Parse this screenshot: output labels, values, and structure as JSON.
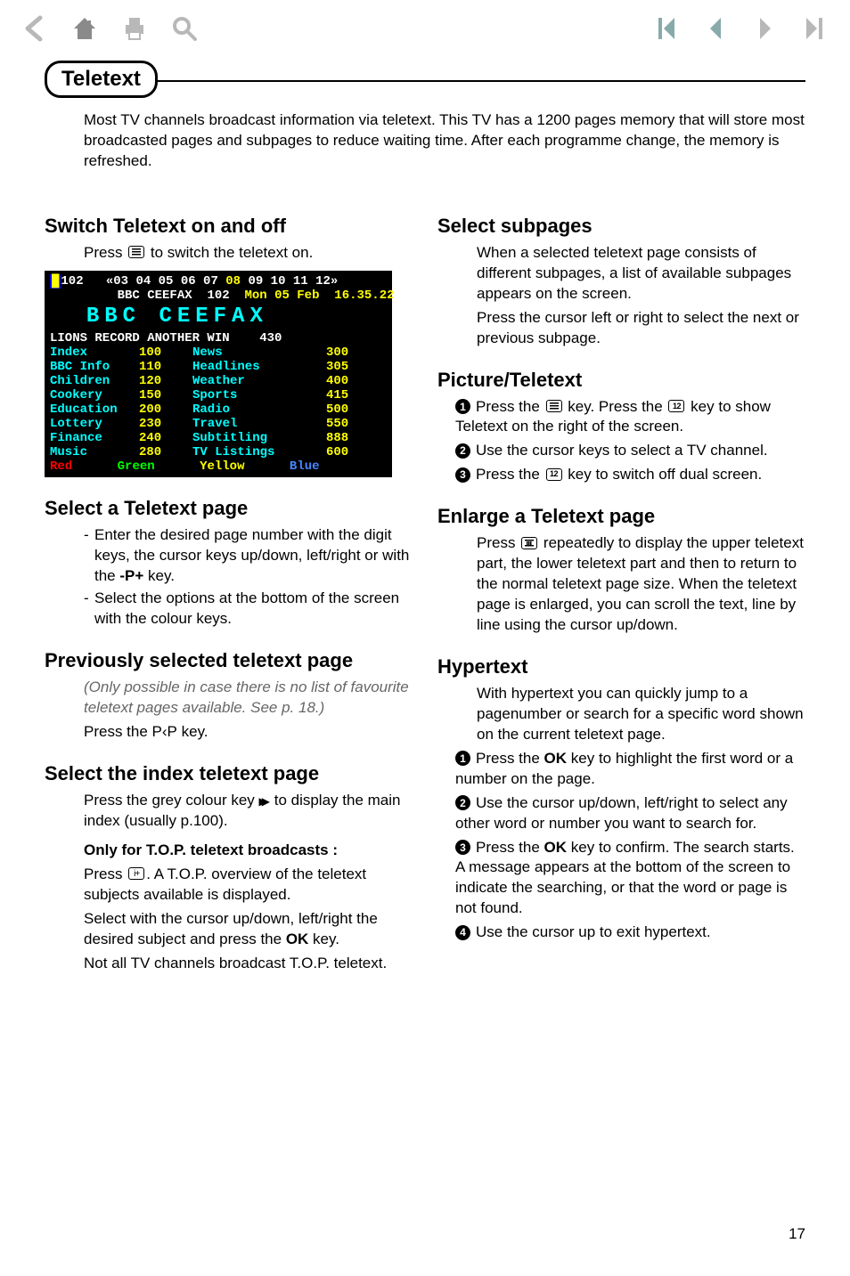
{
  "toolbar_icons": {
    "back": "back-icon",
    "home": "home-icon",
    "print": "print-icon",
    "search": "search-icon",
    "first": "first-page-icon",
    "prev": "prev-page-icon",
    "next": "next-page-icon",
    "last": "last-page-icon"
  },
  "badge": "Teletext",
  "intro": "Most TV channels broadcast information via teletext. This TV has a 1200 pages memory that will store most broadcasted pages and subpages to reduce waiting time.  After each programme change, the memory is refreshed.",
  "left": {
    "switch": {
      "title": "Switch Teletext on and off",
      "line1a": "Press ",
      "line1b": " to switch the teletext on."
    },
    "select_page": {
      "title": "Select a Teletext page",
      "b1": "Enter the desired page number with the digit keys, the cursor keys up/down, left/right or with the ",
      "b1key": "-P+",
      "b1after": " key.",
      "b2": "Select the options at the bottom of the screen with the colour keys."
    },
    "prev_page": {
      "title": "Previously selected teletext page",
      "note": "(Only possible in case there is no list of favourite teletext pages available. See p. 18.)",
      "line": "Press the ",
      "key": "P‹P",
      "after": " key."
    },
    "select_index": {
      "title": "Select the index teletext page",
      "line1a": "Press the grey colour key ",
      "line1b": " to display the main index (usually p.100).",
      "sub": "Only for T.O.P. teletext broadcasts :",
      "p2a": "Press ",
      "p2b": ".  A T.O.P. overview of the teletext subjects available is displayed.",
      "p3a": "Select with the cursor up/down, left/right the desired subject and press the ",
      "p3key": "OK",
      "p3b": " key.",
      "p4": "Not all TV channels broadcast T.O.P. teletext."
    }
  },
  "right": {
    "subpages": {
      "title": "Select subpages",
      "p": "When a selected teletext page consists of different subpages, a list of available subpages appears on the screen.",
      "p2": "Press the cursor left or right to select the next or previous subpage."
    },
    "picture": {
      "title": "Picture/Teletext",
      "s1a": "Press the ",
      "s1b": " key. Press the ",
      "s1c": " key to show Teletext on the right of the screen.",
      "s2": "Use the cursor keys to select a TV channel.",
      "s3a": "Press the ",
      "s3b": " key to switch off dual screen."
    },
    "enlarge": {
      "title": "Enlarge a Teletext page",
      "p1a": "Press ",
      "p1b": " repeatedly to display the upper teletext part, the lower teletext part and then to return to the normal teletext page size. When the teletext page is enlarged, you can scroll the text, line by line using the cursor up/down."
    },
    "hypertext": {
      "title": "Hypertext",
      "p": "With hypertext you can quickly jump to a pagenumber or search for a specific word shown on the current teletext page.",
      "s1a": "Press the ",
      "s1key": "OK",
      "s1b": " key to highlight the first word or a number on the page.",
      "s2": "Use the cursor up/down, left/right to select any other word or number you want to search for.",
      "s3a": "Press the ",
      "s3key": "OK",
      "s3b": " key to confirm. The search starts. A message appears at the bottom of the screen to indicate the searching, or that the word or page is not found.",
      "s4": "Use the cursor up to exit hypertext."
    }
  },
  "teletext_screen": {
    "header_page": "102",
    "header_nums": "«03 04 05 06 07 08 09 10 11 12»",
    "header_highlight_idx": [
      5
    ],
    "header2_a": "BBC CEEFAX  102",
    "header2_b": "Mon 05 Feb",
    "header2_c": "16.35.22",
    "bigline_a": "BBC",
    "bigline_b": "CEEFAX",
    "subhead": "LIONS RECORD ANOTHER WIN    430",
    "rows": [
      {
        "a": "Index",
        "n1": "100",
        "b": "News",
        "n2": "300"
      },
      {
        "a": "BBC Info",
        "n1": "110",
        "b": "Headlines",
        "n2": "305"
      },
      {
        "a": "Children",
        "n1": "120",
        "b": "Weather",
        "n2": "400"
      },
      {
        "a": "Cookery",
        "n1": "150",
        "b": "Sports",
        "n2": "415"
      },
      {
        "a": "Education",
        "n1": "200",
        "b": "Radio",
        "n2": "500"
      },
      {
        "a": "Lottery",
        "n1": "230",
        "b": "Travel",
        "n2": "550"
      },
      {
        "a": "Finance",
        "n1": "240",
        "b": "Subtitling",
        "n2": "888"
      },
      {
        "a": "Music",
        "n1": "280",
        "b": "TV Listings",
        "n2": "600"
      }
    ],
    "footer": {
      "red": "Red",
      "green": "Green",
      "yellow": "Yellow",
      "blue": "Blue"
    }
  },
  "page_number": "17"
}
